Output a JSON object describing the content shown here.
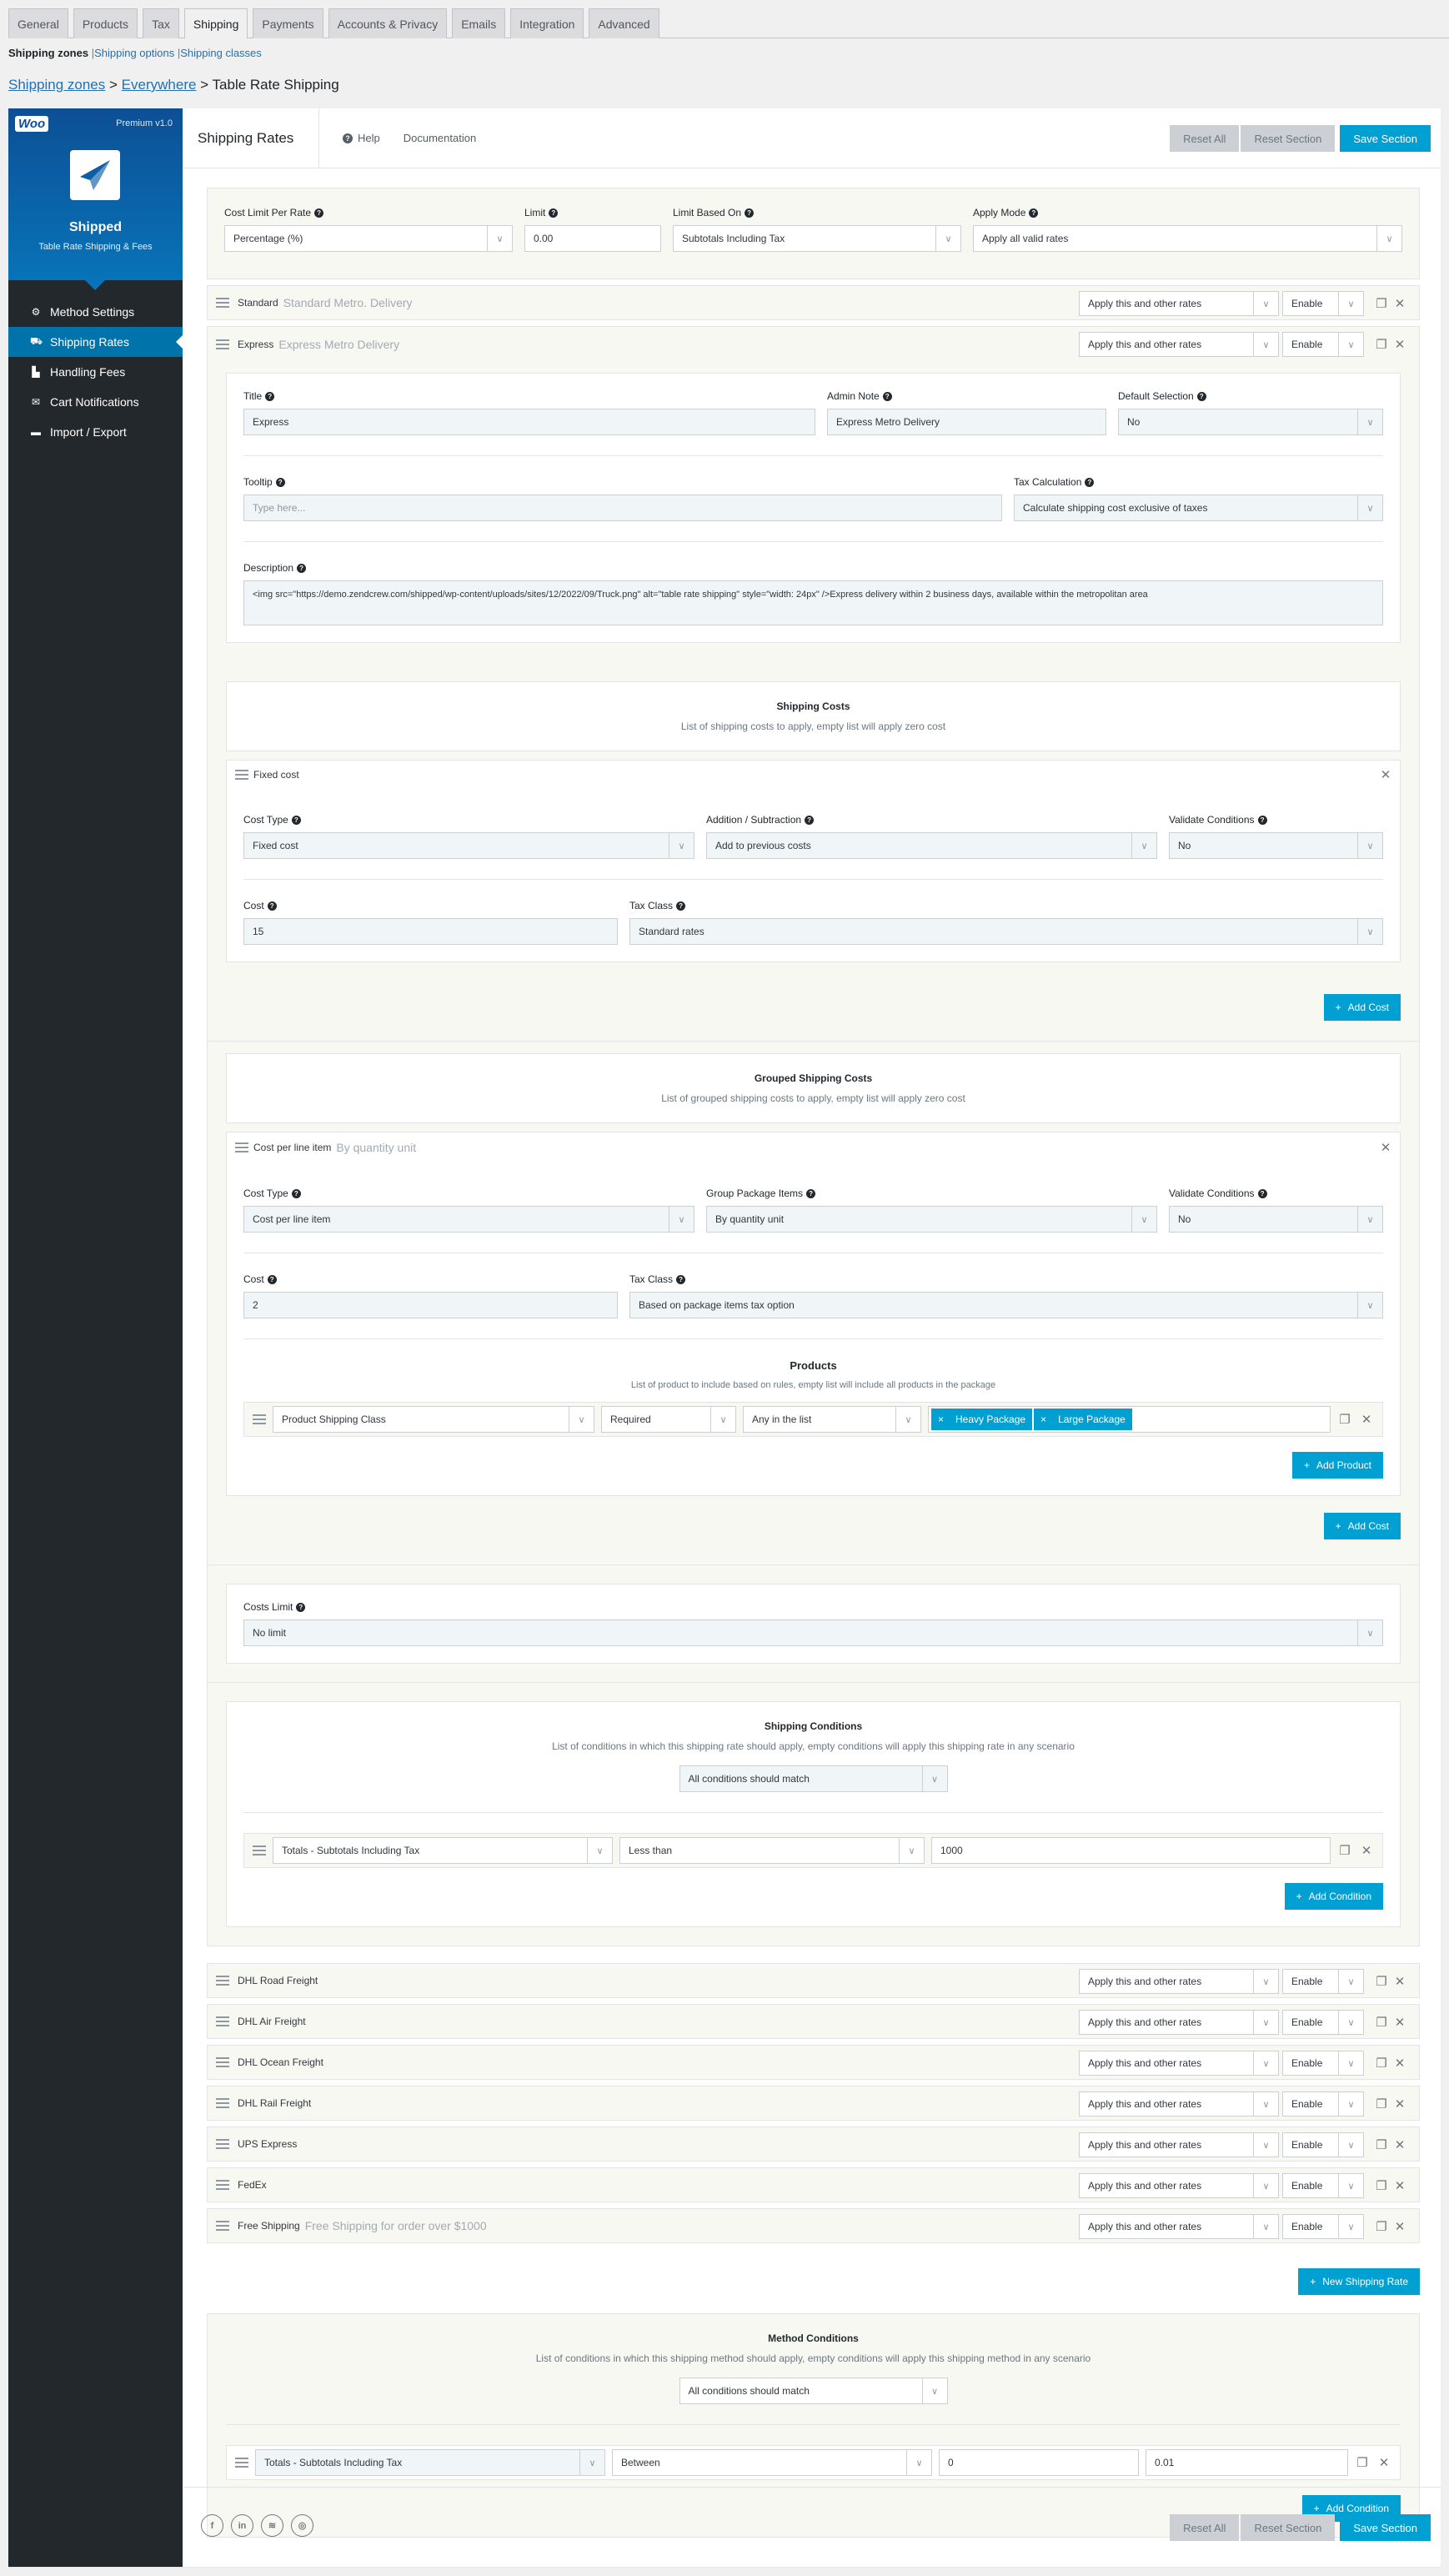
{
  "tabs": [
    "General",
    "Products",
    "Tax",
    "Shipping",
    "Payments",
    "Accounts & Privacy",
    "Emails",
    "Integration",
    "Advanced"
  ],
  "active_tab": "Shipping",
  "subnav": {
    "current": "Shipping zones",
    "links": [
      "Shipping options",
      "Shipping classes"
    ]
  },
  "breadcrumb": {
    "zones": "Shipping zones",
    "zone": "Everywhere",
    "page": "Table Rate Shipping",
    "sep": ">"
  },
  "sidebar": {
    "logo": "Woo",
    "version": "Premium v1.0",
    "name": "Shipped",
    "tagline": "Table Rate Shipping & Fees",
    "items": [
      {
        "label": "Method Settings",
        "icon": "gear-icon"
      },
      {
        "label": "Shipping Rates",
        "icon": "truck-icon",
        "active": true
      },
      {
        "label": "Handling Fees",
        "icon": "dolly-icon"
      },
      {
        "label": "Cart Notifications",
        "icon": "envelope-icon"
      },
      {
        "label": "Import / Export",
        "icon": "card-icon"
      }
    ]
  },
  "header": {
    "title": "Shipping Rates",
    "help": "Help",
    "documentation": "Documentation",
    "reset_all": "Reset All",
    "reset_section": "Reset Section",
    "save_section": "Save Section"
  },
  "top_settings": {
    "cost_limit_label": "Cost Limit Per Rate",
    "cost_limit_value": "Percentage (%)",
    "limit_label": "Limit",
    "limit_value": "0.00",
    "limit_based_label": "Limit Based On",
    "limit_based_value": "Subtotals Including Tax",
    "apply_mode_label": "Apply Mode",
    "apply_mode_value": "Apply all valid rates"
  },
  "rate_controls": {
    "mode": "Apply this and other rates",
    "status": "Enable"
  },
  "rates_before": [
    {
      "name": "Standard",
      "note": "Standard Metro. Delivery"
    },
    {
      "name": "Express",
      "note": "Express Metro Delivery"
    }
  ],
  "express": {
    "title_label": "Title",
    "title_value": "Express",
    "admin_note_label": "Admin Note",
    "admin_note_value": "Express Metro Delivery",
    "default_label": "Default Selection",
    "default_value": "No",
    "tooltip_label": "Tooltip",
    "tooltip_placeholder": "Type here...",
    "tax_calc_label": "Tax Calculation",
    "tax_calc_value": "Calculate shipping cost exclusive of taxes",
    "description_label": "Description",
    "description_value": "<img src=\"https://demo.zendcrew.com/shipped/wp-content/uploads/sites/12/2022/09/Truck.png\" alt=\"table rate shipping\" style=\"width: 24px\" />Express delivery within 2 business days, available within the metropolitan area"
  },
  "shipping_costs": {
    "title": "Shipping Costs",
    "desc": "List of shipping costs to apply, empty list will apply zero cost",
    "item_title": "Fixed cost",
    "cost_type_label": "Cost Type",
    "cost_type_value": "Fixed cost",
    "addsub_label": "Addition / Subtraction",
    "addsub_value": "Add to previous costs",
    "validate_label": "Validate Conditions",
    "validate_value": "No",
    "cost_label": "Cost",
    "cost_value": "15",
    "tax_class_label": "Tax Class",
    "tax_class_value": "Standard rates",
    "add_cost": "Add Cost"
  },
  "grouped_costs": {
    "title": "Grouped Shipping Costs",
    "desc": "List of grouped shipping costs to apply, empty list will apply zero cost",
    "item_title": "Cost per line item",
    "item_note": "By quantity unit",
    "cost_type_label": "Cost Type",
    "cost_type_value": "Cost per line item",
    "group_label": "Group Package Items",
    "group_value": "By quantity unit",
    "validate_label": "Validate Conditions",
    "validate_value": "No",
    "cost_label": "Cost",
    "cost_value": "2",
    "tax_class_label": "Tax Class",
    "tax_class_value": "Based on package items tax option",
    "products_title": "Products",
    "products_desc": "List of product to include based on rules, empty list will include all products in the package",
    "product_rule": {
      "type": "Product Shipping Class",
      "req": "Required",
      "match": "Any in the list",
      "chips": [
        "Heavy Package",
        "Large Package"
      ]
    },
    "add_product": "Add Product",
    "add_cost": "Add Cost"
  },
  "costs_limit": {
    "label": "Costs Limit",
    "value": "No limit"
  },
  "shipping_conditions": {
    "title": "Shipping Conditions",
    "desc": "List of conditions in which this shipping rate should apply, empty conditions will apply this shipping rate in any scenario",
    "match": "All conditions should match",
    "condition": {
      "field": "Totals - Subtotals Including Tax",
      "op": "Less than",
      "value": "1000"
    },
    "add": "Add Condition"
  },
  "rates_after": [
    {
      "name": "DHL Road Freight",
      "note": ""
    },
    {
      "name": "DHL Air Freight",
      "note": ""
    },
    {
      "name": "DHL Ocean Freight",
      "note": ""
    },
    {
      "name": "DHL Rail Freight",
      "note": ""
    },
    {
      "name": "UPS Express",
      "note": ""
    },
    {
      "name": "FedEx",
      "note": ""
    },
    {
      "name": "Free Shipping",
      "note": "Free Shipping for order over $1000"
    }
  ],
  "new_rate": "New Shipping Rate",
  "method_conditions": {
    "title": "Method Conditions",
    "desc": "List of conditions in which this shipping method should apply, empty conditions will apply this shipping method in any scenario",
    "match": "All conditions should match",
    "condition": {
      "field": "Totals - Subtotals Including Tax",
      "op": "Between",
      "min": "0",
      "max": "0.01"
    },
    "add": "Add Condition"
  },
  "social": [
    "facebook-icon",
    "linkedin-icon",
    "stackoverflow-icon",
    "instagram-icon"
  ],
  "colors": {
    "primary": "#00a0d2",
    "sidebar": "#23282d",
    "active_nav": "#0073aa",
    "muted_button": "#ccd0d4"
  }
}
